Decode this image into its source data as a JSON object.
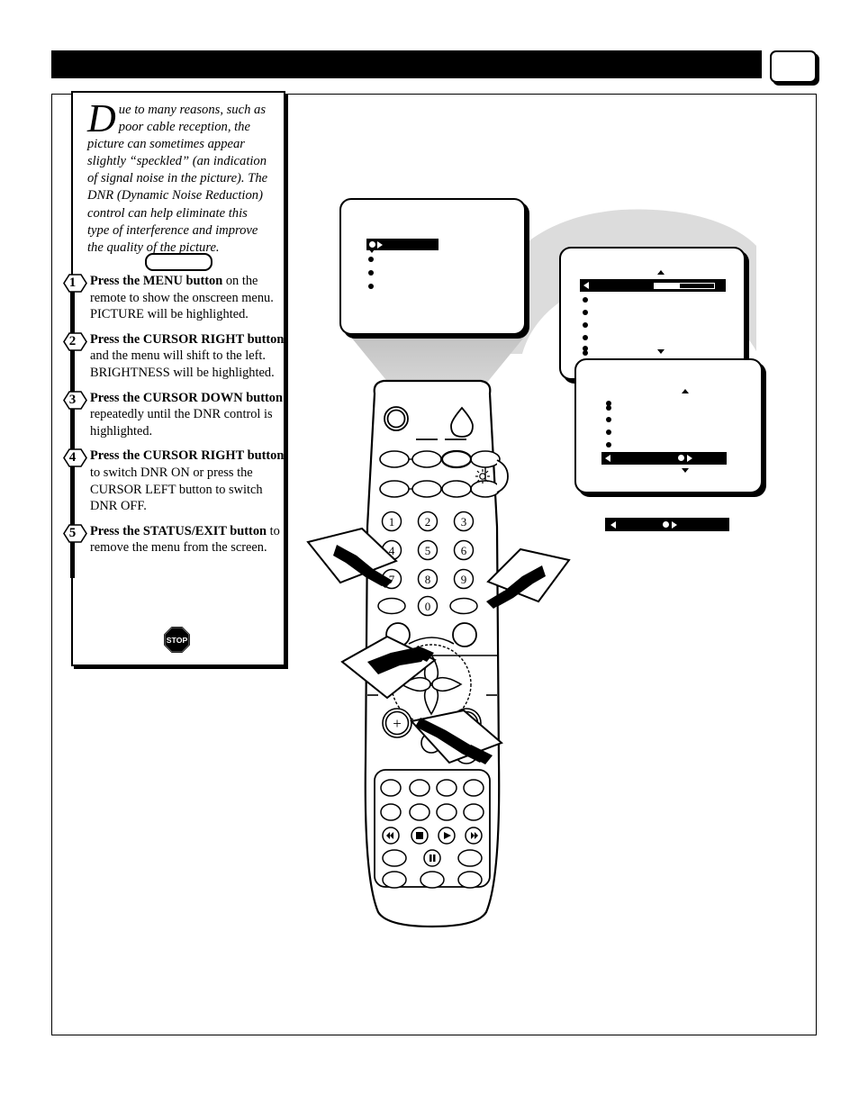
{
  "header": {
    "title": "",
    "page_number": ""
  },
  "intro": {
    "dropcap": "D",
    "body": "ue to many reasons, such as poor cable reception, the picture can sometimes appear slightly “speckled” (an indication of signal noise in the picture).  The DNR (Dynamic Noise Reduction) control can help eliminate this type of interference and improve the quality of the picture."
  },
  "steps": [
    {
      "number": "1",
      "bold_lead": "Press the MENU button",
      "rest": " on the remote to show the onscreen menu. PICTURE will be highlighted."
    },
    {
      "number": "2",
      "bold_lead": "Press the CURSOR RIGHT button",
      "rest": " and the menu will shift to the left.  BRIGHTNESS  will be highlighted."
    },
    {
      "number": "3",
      "bold_lead": "Press the CURSOR DOWN button",
      "rest": " repeatedly until the DNR control is highlighted."
    },
    {
      "number": "4",
      "bold_lead": "Press the CURSOR RIGHT button",
      "rest": " to switch DNR ON or press the CURSOR LEFT button to switch DNR OFF."
    },
    {
      "number": "5",
      "bold_lead": "Press the STATUS/EXIT button",
      "rest": " to remove the menu from the screen."
    }
  ],
  "stop_icon": {
    "label": "STOP"
  },
  "tv_screens": [
    {
      "id": "screen-1",
      "highlighted_item": "",
      "items": [
        "",
        "",
        ""
      ]
    },
    {
      "id": "screen-2",
      "highlighted_item": "",
      "slider_value": "",
      "items": [
        "",
        "",
        "",
        "",
        ""
      ]
    },
    {
      "id": "screen-3",
      "highlighted_item": "",
      "items": [
        "",
        "",
        "",
        ""
      ]
    }
  ],
  "status_bar": {
    "text": ""
  },
  "remote": {
    "keypad": [
      "1",
      "2",
      "3",
      "4",
      "5",
      "6",
      "7",
      "8",
      "9",
      "0"
    ],
    "volume_up": "+",
    "volume_down": "−",
    "channel_up": "+",
    "channel_down": "−",
    "transport": {
      "rewind": "◀◀",
      "stop": "■",
      "play": "▶",
      "forward": "▶▶",
      "pause": "❙❙"
    }
  },
  "colors": {
    "ink": "#000000",
    "paper": "#ffffff",
    "beam": "#d4d4d4",
    "swoosh": "#dcdcdc"
  }
}
